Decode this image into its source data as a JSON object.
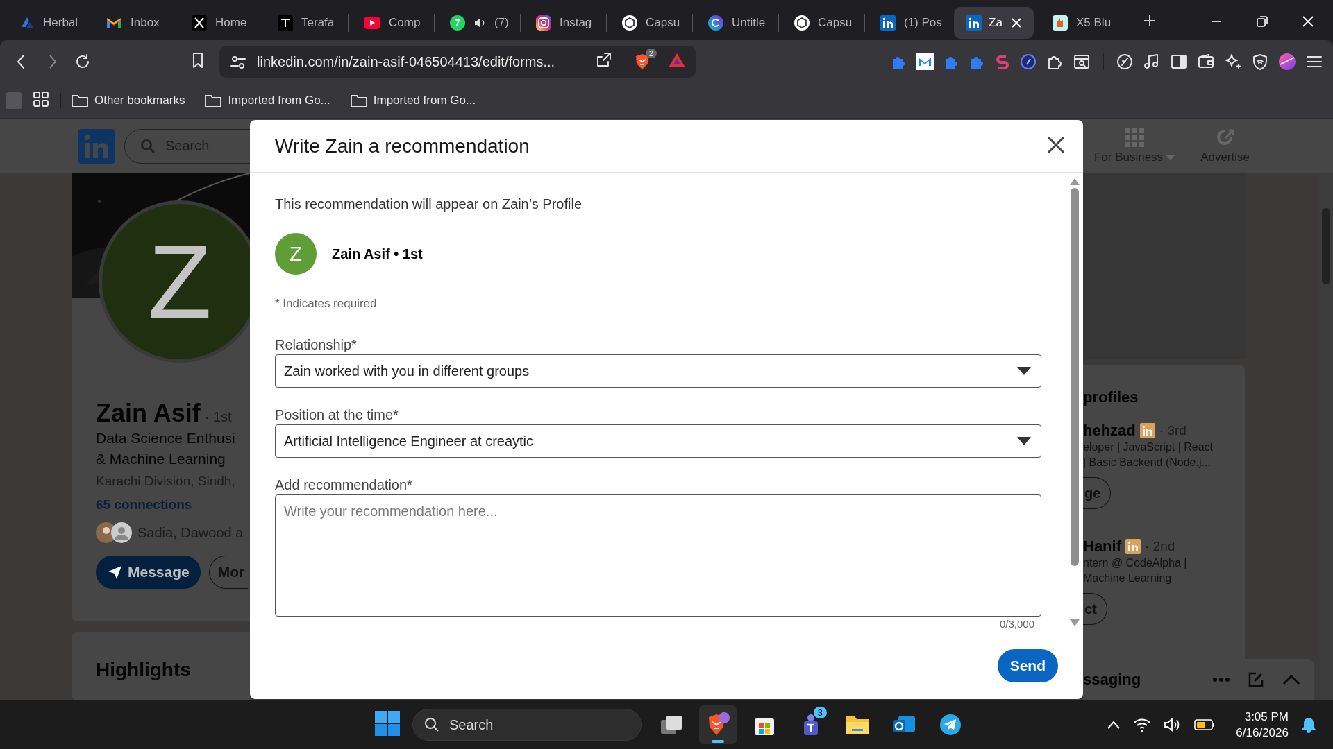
{
  "browser": {
    "tabs": [
      {
        "title": "Herbal",
        "selected": false,
        "audio": false
      },
      {
        "title": "Inbox",
        "selected": false,
        "audio": false
      },
      {
        "title": "Home",
        "selected": false,
        "audio": false
      },
      {
        "title": "Terafa",
        "selected": false,
        "audio": false
      },
      {
        "title": "Comp",
        "selected": false,
        "audio": false
      },
      {
        "title": "(7)",
        "badge": "7",
        "selected": false,
        "audio": true
      },
      {
        "title": "Instag",
        "selected": false,
        "audio": false
      },
      {
        "title": "Capsu",
        "selected": false,
        "audio": false
      },
      {
        "title": "Untitle",
        "selected": false,
        "audio": false
      },
      {
        "title": "Capsu",
        "selected": false,
        "audio": false
      },
      {
        "title": "(1) Pos",
        "selected": false,
        "audio": false
      },
      {
        "title": "Za",
        "selected": true,
        "audio": false
      },
      {
        "title": "X5 Blu",
        "selected": false,
        "audio": false
      }
    ],
    "address": "linkedin.com/in/zain-asif-046504413/edit/forms...",
    "shields_count": "2",
    "bookmarks": [
      "Other bookmarks",
      "Imported from Go...",
      "Imported from Go..."
    ]
  },
  "page": {
    "search_placeholder": "Search",
    "nav": [
      "For Business",
      "Advertise"
    ],
    "profile": {
      "avatar_letter": "Z",
      "name": "Zain Asif",
      "degree": "· 1st",
      "headline": [
        "Data Science Enthusi",
        "& Machine Learning"
      ],
      "location": "Karachi Division, Sindh,",
      "connections": "65 connections",
      "mutual": "Sadia, Dawood a",
      "buttons": [
        "Message",
        "Mor"
      ]
    },
    "highlights_title": "Highlights",
    "side_card": {
      "title": "profiles",
      "people": [
        {
          "name": "hehzad",
          "degree": "· 3rd",
          "lines": [
            "eloper | JavaScript | React",
            "| Basic Backend (Node.j..."
          ],
          "button": "ge"
        },
        {
          "name": "Hanif",
          "degree": "· 2nd",
          "lines": [
            "ntern @ CodeAlpha |",
            "Machine Learning"
          ],
          "button": "ct"
        }
      ]
    },
    "messaging": "ssaging"
  },
  "modal": {
    "title": "Write Zain a recommendation",
    "notice": "This recommendation will appear on Zain’s Profile",
    "recipient": {
      "initial": "Z",
      "name": "Zain Asif • 1st"
    },
    "required_note": "* Indicates required",
    "fields": [
      {
        "kind": "select",
        "label": "Relationship*",
        "value": "Zain worked with you in different groups"
      },
      {
        "kind": "select",
        "label": "Position at the time*",
        "value": "Artificial Intelligence Engineer at creaytic"
      },
      {
        "kind": "textarea",
        "label": "Add recommendation*",
        "placeholder": "Write your recommendation here...",
        "counter": "0/3,000"
      }
    ],
    "send": "Send"
  },
  "taskbar": {
    "search_placeholder": "Search",
    "apps": [
      {
        "active": false
      },
      {
        "active": true
      },
      {
        "active": false
      },
      {
        "active": false,
        "badge": "3"
      },
      {
        "active": false
      },
      {
        "active": false
      },
      {
        "active": false
      }
    ],
    "time": "3:05 PM",
    "date": "6/16/2026"
  }
}
